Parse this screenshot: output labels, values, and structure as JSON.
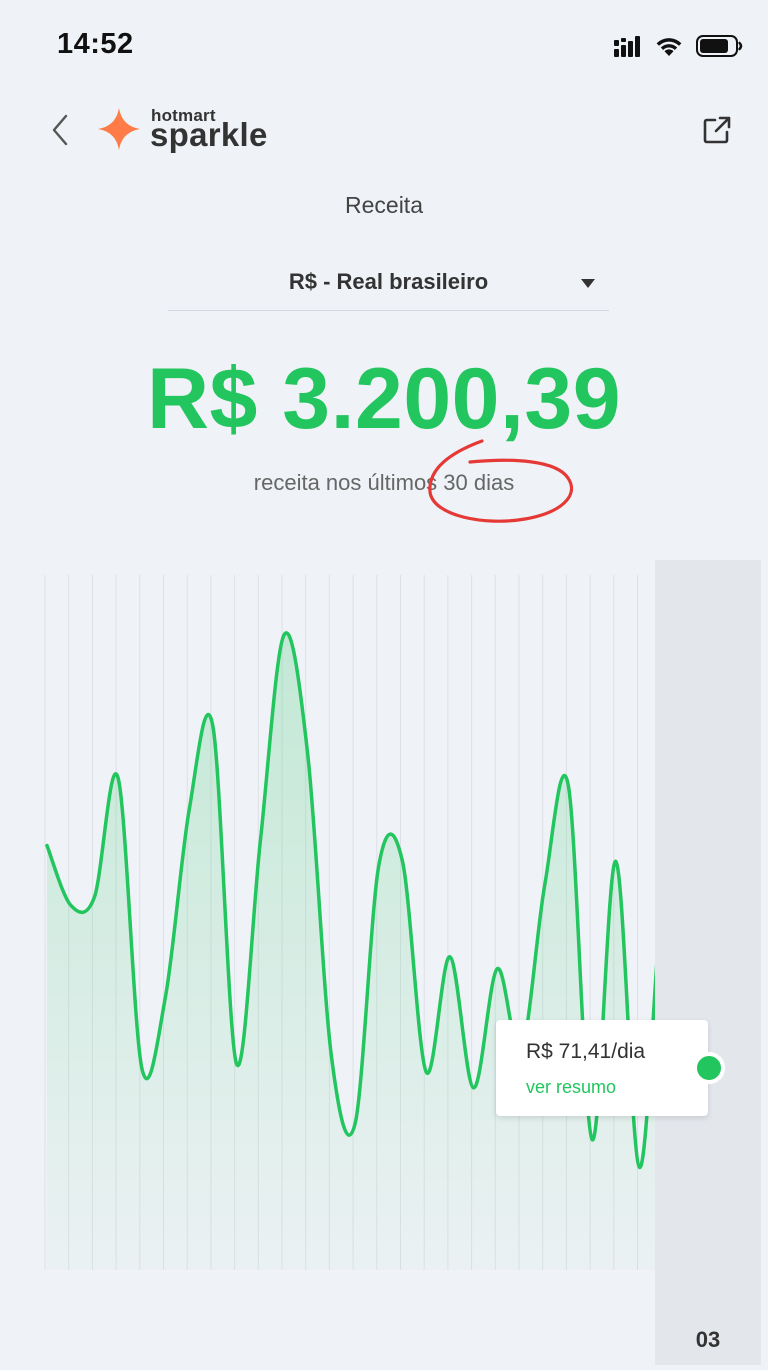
{
  "status_bar": {
    "time": "14:52",
    "icons": [
      "signal-icon",
      "wifi-icon",
      "battery-icon"
    ]
  },
  "header": {
    "back_icon": "chevron-left-icon",
    "logo": {
      "icon": "sparkle-star-icon",
      "small_text": "hotmart",
      "big_text": "sparkle",
      "color": "#ff7b48"
    },
    "external_icon": "external-link-icon"
  },
  "page": {
    "title": "Receita"
  },
  "currency_select": {
    "selected": "R$ - Real brasileiro",
    "icon": "caret-down-icon"
  },
  "total": {
    "amount": "R$ 3.200,39",
    "caption": "receita nos últimos 30 dias",
    "color": "#22c55e"
  },
  "annotation": {
    "type": "hand-drawn-circle",
    "color": "#e53935"
  },
  "chart_data": {
    "type": "area",
    "title": "",
    "xlabel": "",
    "ylabel": "",
    "visible_tick_labels": [
      "03"
    ],
    "series": [
      {
        "values": [
          93,
          78,
          80,
          110,
          37,
          55,
          102,
          123,
          38,
          94,
          146,
          116,
          40,
          23,
          88,
          89,
          36,
          65,
          32,
          62,
          41,
          83,
          108,
          19,
          89,
          12,
          80,
          70,
          48,
          0
        ]
      }
    ],
    "selected_point": {
      "index": 29,
      "tooltip_value": "R$ 71,41/dia",
      "tooltip_link": "ver resumo"
    },
    "line_color": "#22c55e",
    "fill_color": "#22c55e",
    "grid": "vertical"
  }
}
